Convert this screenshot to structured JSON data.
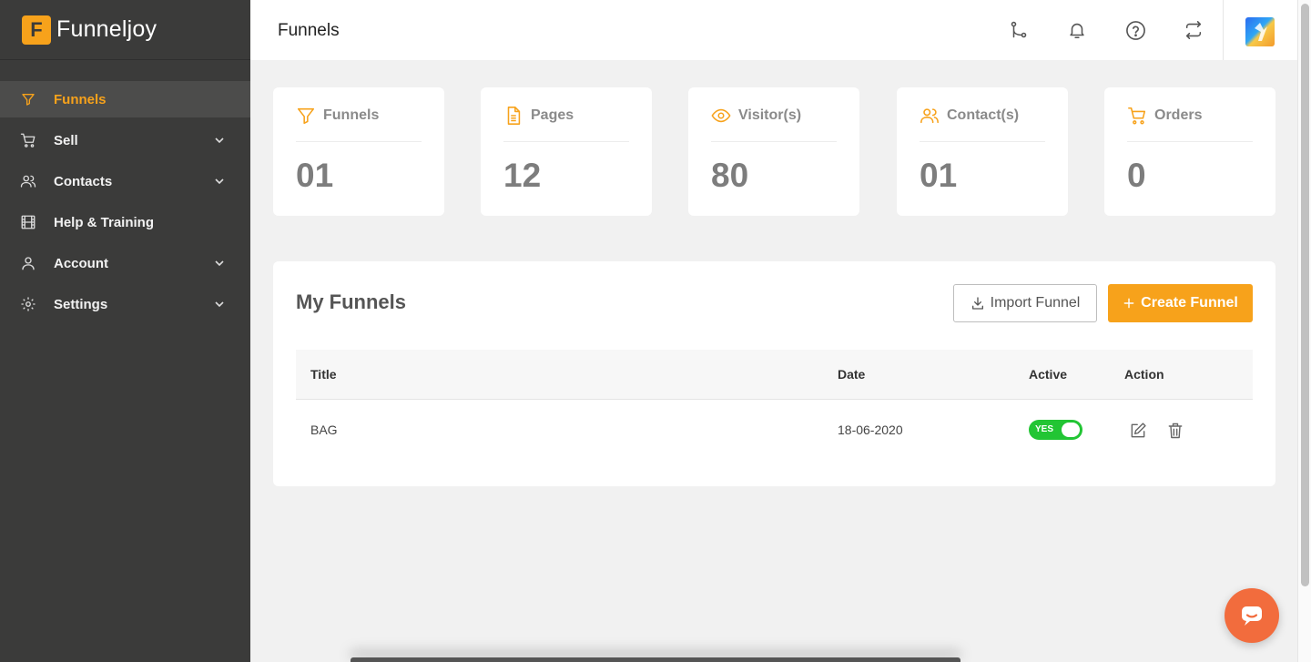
{
  "brand": {
    "logo_letter": "F",
    "name": "Funneljoy",
    "accent": "#f7a21b"
  },
  "sidebar": {
    "items": [
      {
        "label": "Funnels",
        "icon": "filter-icon",
        "active": true,
        "has_children": false
      },
      {
        "label": "Sell",
        "icon": "cart-icon",
        "active": false,
        "has_children": true
      },
      {
        "label": "Contacts",
        "icon": "users-icon",
        "active": false,
        "has_children": true
      },
      {
        "label": "Help & Training",
        "icon": "film-icon",
        "active": false,
        "has_children": false
      },
      {
        "label": "Account",
        "icon": "user-icon",
        "active": false,
        "has_children": true
      },
      {
        "label": "Settings",
        "icon": "gear-icon",
        "active": false,
        "has_children": true
      }
    ]
  },
  "header": {
    "title": "Funnels",
    "icons": [
      "branch-icon",
      "bell-icon",
      "help-circle-icon",
      "switch-icon"
    ]
  },
  "stats": [
    {
      "label": "Funnels",
      "value": "01",
      "icon": "filter-icon"
    },
    {
      "label": "Pages",
      "value": "12",
      "icon": "document-icon"
    },
    {
      "label": "Visitor(s)",
      "value": "80",
      "icon": "eye-icon"
    },
    {
      "label": "Contact(s)",
      "value": "01",
      "icon": "users-icon"
    },
    {
      "label": "Orders",
      "value": "0",
      "icon": "cart-icon"
    }
  ],
  "funnels_panel": {
    "title": "My Funnels",
    "import_label": "Import Funnel",
    "create_label": "Create Funnel",
    "columns": [
      "Title",
      "Date",
      "Active",
      "Action"
    ],
    "rows": [
      {
        "title": "BAG",
        "date": "18-06-2020",
        "active_label": "YES",
        "active": true
      }
    ]
  }
}
